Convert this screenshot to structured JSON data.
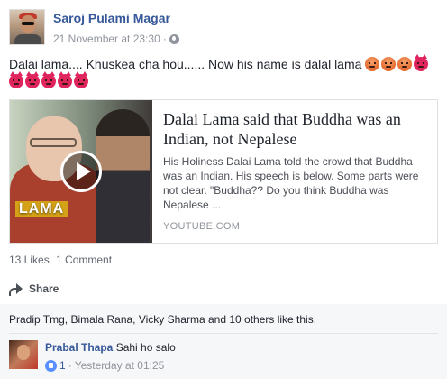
{
  "post": {
    "author": "Saroj Pulami Magar",
    "timestamp": "21 November at 23:30",
    "separator": "·",
    "privacy_icon": "globe-icon",
    "text": "Dalai lama.... Khuskea cha hou...... Now his name is dalal lama",
    "emojis_line1": [
      "angry",
      "angry",
      "angry",
      "devil"
    ],
    "emojis_line2": [
      "devil",
      "devil",
      "devil",
      "devil",
      "devil"
    ]
  },
  "link": {
    "title": "Dalai Lama said that Buddha was an Indian, not Nepalese",
    "description": "His Holiness Dalai Lama told the crowd that Buddha was an Indian. His speech is below. Some parts were not clear. \"Buddha?? Do you think Buddha was Nepalese ...",
    "source": "YOUTUBE.COM",
    "thumbnail_label": "LAMA"
  },
  "stats": {
    "likes": "13 Likes",
    "comments": "1 Comment"
  },
  "actions": {
    "share_label": "Share"
  },
  "likes_summary": "Pradip Tmg, Bimala Rana, Vicky Sharma and 10 others like this.",
  "comment": {
    "author": "Prabal Thapa",
    "text": "Sahi ho salo",
    "like_count": "1",
    "separator": "·",
    "timestamp": "Yesterday at 01:25"
  },
  "colors": {
    "link_blue": "#365899",
    "meta_gray": "#90949c",
    "border": "#dddfe2"
  }
}
